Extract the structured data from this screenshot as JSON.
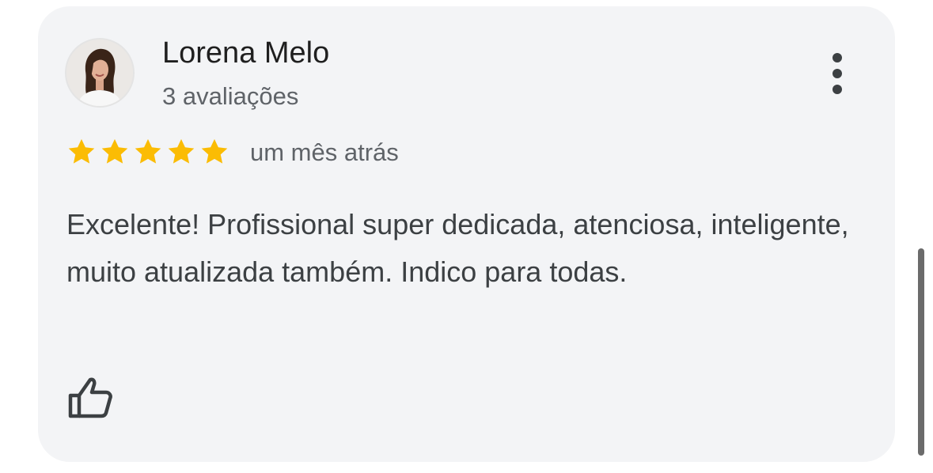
{
  "review": {
    "author": "Lorena Melo",
    "review_count": "3 avaliações",
    "rating": 5,
    "rating_max": 5,
    "time_ago": "um mês atrás",
    "text": "Excelente! Profissional super dedicada, atenciosa, inteligente, muito atualizada também. Indico para todas."
  },
  "icons": {
    "menu": "more-vert-icon",
    "like": "thumb-up-icon",
    "star": "star-icon"
  },
  "colors": {
    "card_background": "#f3f4f6",
    "star": "#fbbc04",
    "primary_text": "#1f1f1f",
    "secondary_text": "#5f6368",
    "body_text": "#3c4043",
    "scrollbar": "#6b6b6b"
  }
}
